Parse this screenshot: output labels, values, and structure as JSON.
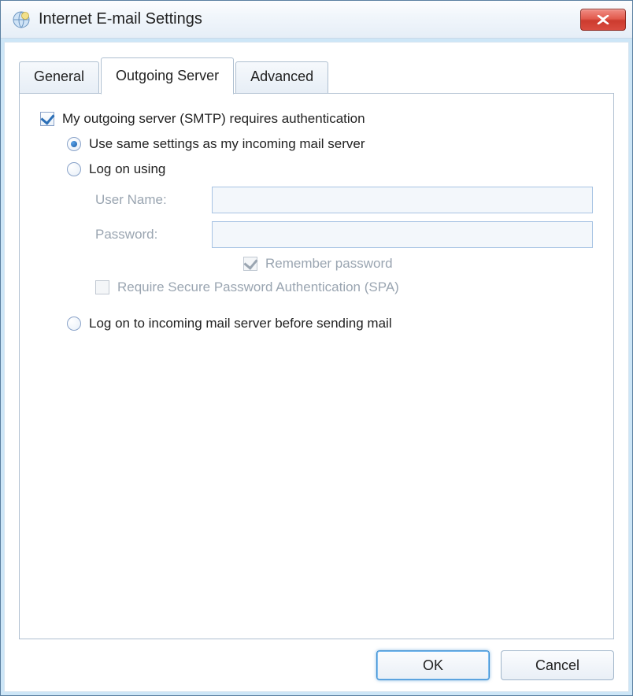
{
  "window": {
    "title": "Internet E-mail Settings"
  },
  "tabs": {
    "general": "General",
    "outgoing": "Outgoing Server",
    "advanced": "Advanced"
  },
  "outgoing": {
    "requires_auth_label": "My outgoing server (SMTP) requires authentication",
    "requires_auth_checked": true,
    "use_same_label": "Use same settings as my incoming mail server",
    "log_on_using_label": "Log on using",
    "user_name_label": "User Name:",
    "user_name_value": "",
    "password_label": "Password:",
    "password_value": "",
    "remember_password_label": "Remember password",
    "remember_password_checked": true,
    "require_spa_label": "Require Secure Password Authentication (SPA)",
    "require_spa_checked": false,
    "log_on_incoming_label": "Log on to incoming mail server before sending mail",
    "selected_option": "use_same"
  },
  "buttons": {
    "ok": "OK",
    "cancel": "Cancel"
  }
}
